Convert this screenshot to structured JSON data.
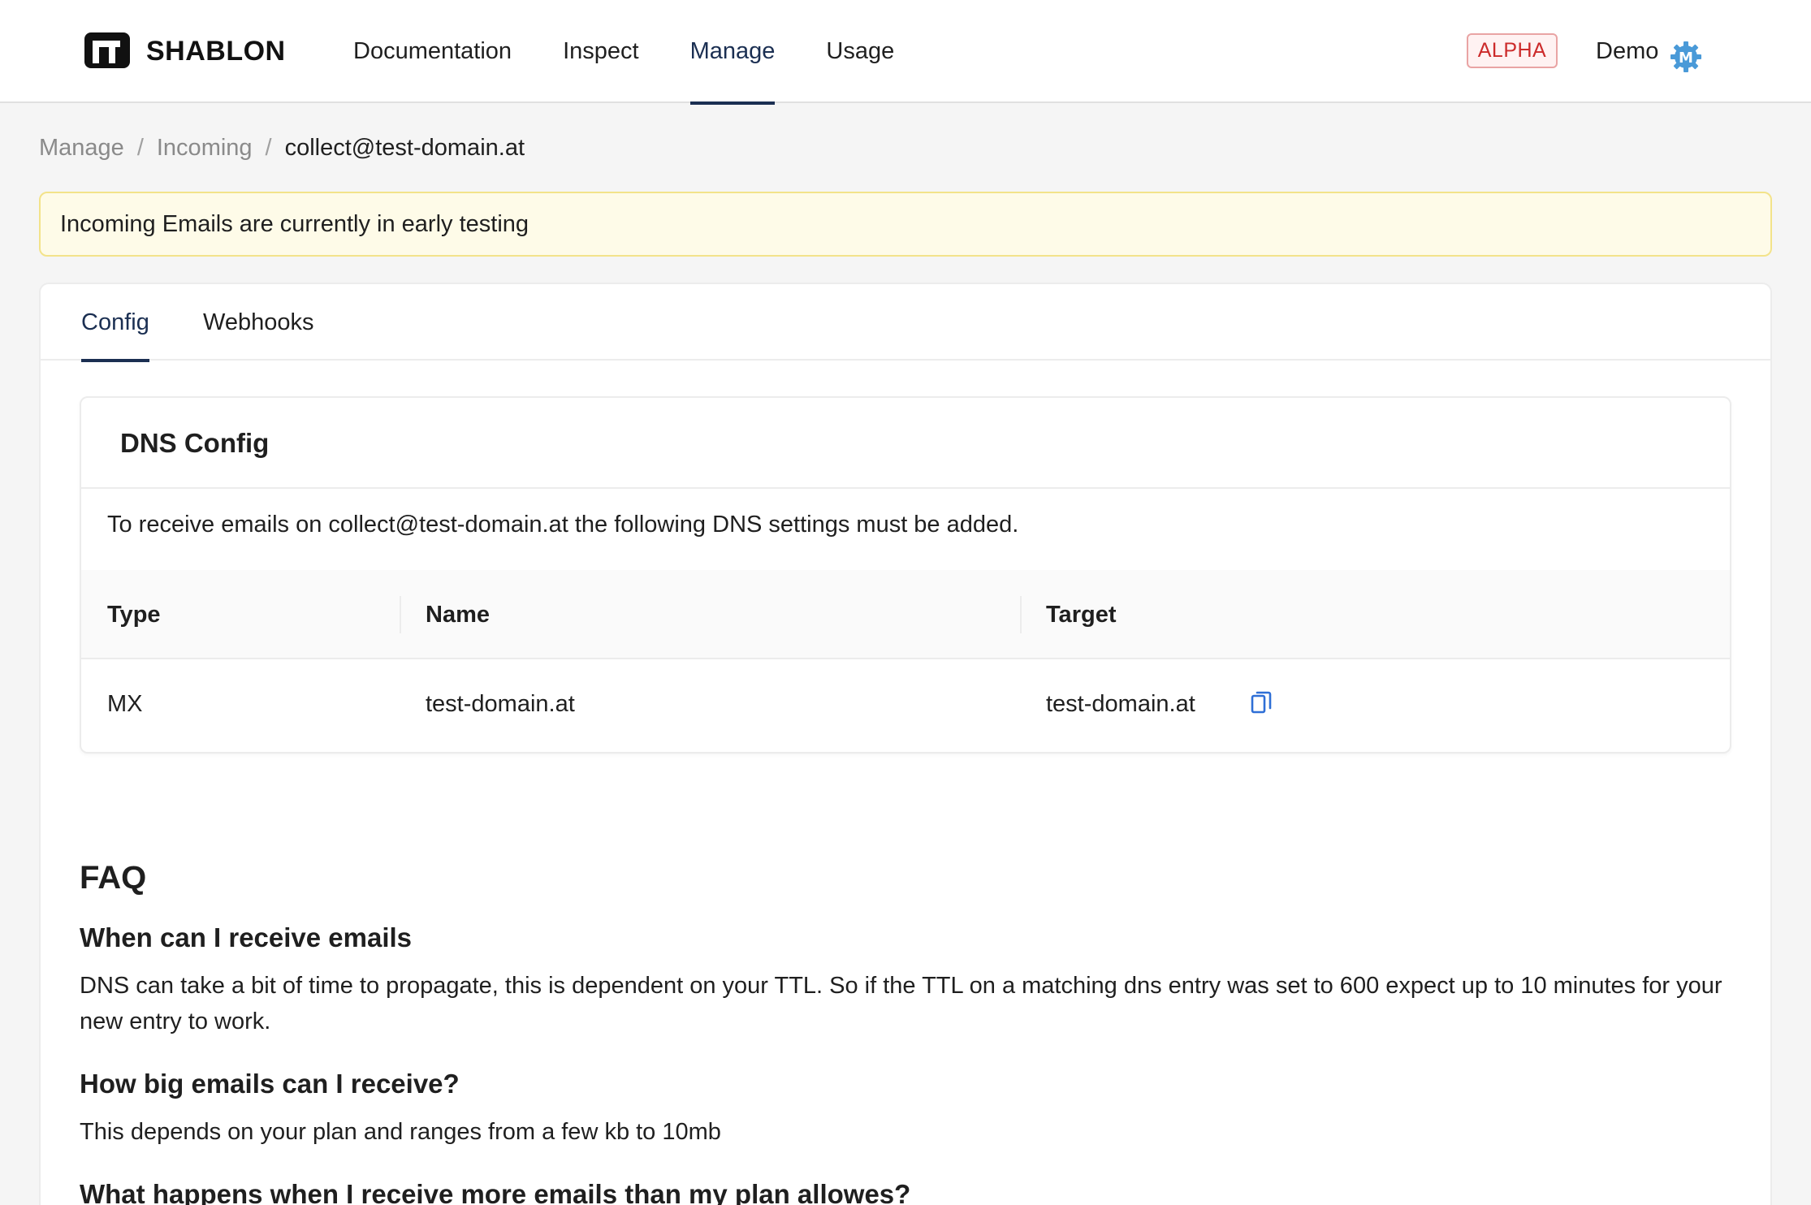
{
  "header": {
    "brand": "SHABLON",
    "nav": [
      {
        "label": "Documentation",
        "active": false
      },
      {
        "label": "Inspect",
        "active": false
      },
      {
        "label": "Manage",
        "active": true
      },
      {
        "label": "Usage",
        "active": false
      }
    ],
    "badge": "ALPHA",
    "user": "Demo",
    "avatar_letter": "M"
  },
  "breadcrumb": {
    "items": [
      "Manage",
      "Incoming"
    ],
    "current": "collect@test-domain.at",
    "separator": "/"
  },
  "alert": {
    "text": "Incoming Emails are currently in early testing"
  },
  "tabs": [
    {
      "label": "Config",
      "active": true
    },
    {
      "label": "Webhooks",
      "active": false
    }
  ],
  "dns": {
    "title": "DNS Config",
    "description": "To receive emails on collect@test-domain.at the following DNS settings must be added.",
    "columns": [
      "Type",
      "Name",
      "Target"
    ],
    "rows": [
      {
        "type": "MX",
        "name": "test-domain.at",
        "target": "test-domain.at"
      }
    ]
  },
  "faq": {
    "title": "FAQ",
    "items": [
      {
        "q": "When can I receive emails",
        "a": "DNS can take a bit of time to propagate, this is dependent on your TTL. So if the TTL on a matching dns entry was set to 600 expect up to 10 minutes for your new entry to work."
      },
      {
        "q": "How big emails can I receive?",
        "a": "This depends on your plan and ranges from a few kb to 10mb"
      },
      {
        "q": "What happens when I receive more emails than my plan allowes?",
        "a": ""
      }
    ]
  },
  "colors": {
    "primary": "#1b2f52",
    "alert_bg": "#fefbe8",
    "alert_border": "#f3e38a",
    "badge_text": "#cc2b2b",
    "copy_icon": "#2f6fd6",
    "avatar": "#4a9ad8"
  }
}
